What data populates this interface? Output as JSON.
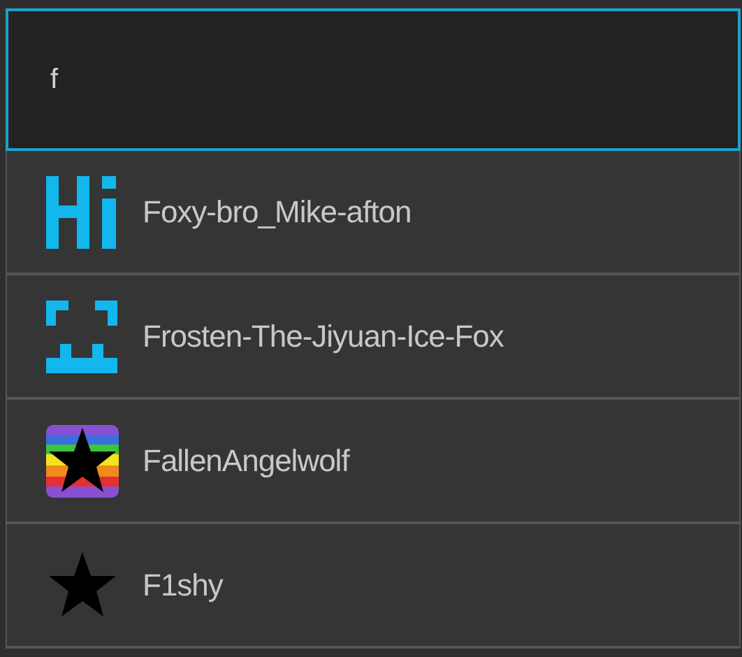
{
  "search": {
    "value": "f"
  },
  "results": [
    {
      "name": "Foxy-bro_Mike-afton",
      "kind": "hi"
    },
    {
      "name": "Frosten-The-Jiyuan-Ice-Fox",
      "kind": "face"
    },
    {
      "name": "FallenAngelwolf",
      "kind": "rainbow"
    },
    {
      "name": "F1shy",
      "kind": "star"
    }
  ]
}
